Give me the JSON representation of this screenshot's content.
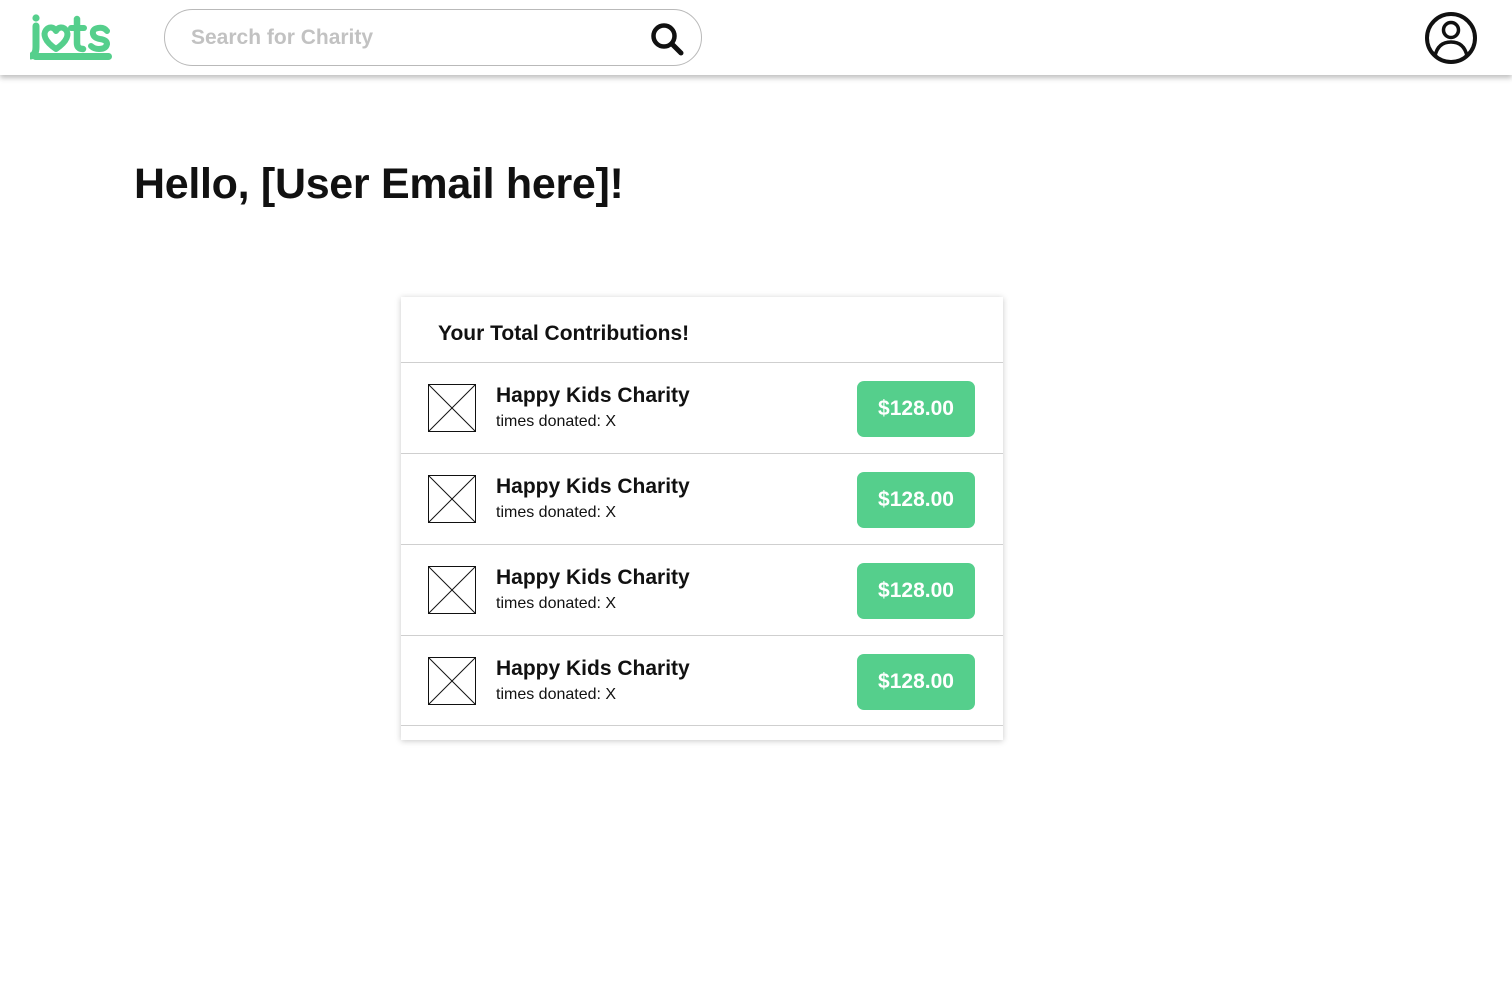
{
  "header": {
    "logo_text": "jots",
    "search_placeholder": "Search for Charity",
    "search_value": ""
  },
  "greeting": "Hello, [User Email here]!",
  "contributions": {
    "title": "Your Total Contributions!",
    "rows": [
      {
        "name": "Happy Kids Charity",
        "times": "times donated: X",
        "amount": "$128.00"
      },
      {
        "name": "Happy Kids Charity",
        "times": "times donated: X",
        "amount": "$128.00"
      },
      {
        "name": "Happy Kids Charity",
        "times": "times donated: X",
        "amount": "$128.00"
      },
      {
        "name": "Happy Kids Charity",
        "times": "times donated: X",
        "amount": "$128.00"
      }
    ]
  },
  "colors": {
    "brand_green": "#55cf8c",
    "text": "#111111",
    "divider": "#cfcfcf"
  },
  "icons": [
    "jots-logo",
    "search-icon",
    "user-avatar-icon",
    "image-placeholder-icon"
  ]
}
